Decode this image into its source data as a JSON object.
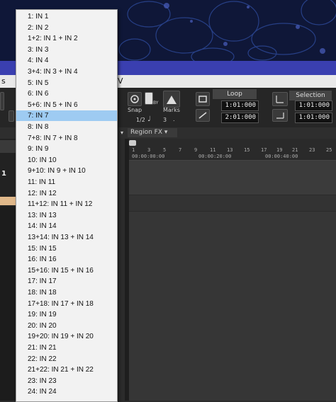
{
  "menubar": {
    "items": [
      "s",
      "V"
    ]
  },
  "toolbar": {
    "snap_label": "Snap",
    "marks_label": "Marks",
    "snap_value": "1/2",
    "marks_value": "3",
    "by_label": "BY",
    "loop": {
      "title": "Loop",
      "start": "1:01:000",
      "end": "2:01:000"
    },
    "selection": {
      "title": "Selection",
      "start": "1:01:000",
      "end": "1:01:000"
    }
  },
  "track_header": {
    "region_fx": "Region FX"
  },
  "ruler": {
    "bars": [
      "1",
      "3",
      "5",
      "7",
      "9",
      "11",
      "13",
      "15",
      "17",
      "19",
      "21",
      "23",
      "25"
    ],
    "times": [
      "00:00:00:00",
      "00:00:20:00",
      "00:00:40:00"
    ]
  },
  "left_panel": {
    "track_number": "1"
  },
  "dropdown": {
    "selected_index": 6,
    "items": [
      "1: IN 1",
      "2: IN 2",
      "1+2: IN 1 + IN 2",
      "3: IN 3",
      "4: IN 4",
      "3+4: IN 3 + IN 4",
      "5: IN 5",
      "6: IN 6",
      "5+6: IN 5 + IN 6",
      "7: IN 7",
      "8: IN 8",
      "7+8: IN 7 + IN 8",
      "9: IN 9",
      "10: IN 10",
      "9+10: IN 9 + IN 10",
      "11: IN 11",
      "12: IN 12",
      "11+12: IN 11 + IN 12",
      "13: IN 13",
      "14: IN 14",
      "13+14: IN 13 + IN 14",
      "15: IN 15",
      "16: IN 16",
      "15+16: IN 15 + IN 16",
      "17: IN 17",
      "18: IN 18",
      "17+18: IN 17 + IN 18",
      "19: IN 19",
      "20: IN 20",
      "19+20: IN 19 + IN 20",
      "21: IN 21",
      "22: IN 22",
      "21+22: IN 21 + IN 22",
      "23: IN 23",
      "24: IN 24"
    ]
  }
}
